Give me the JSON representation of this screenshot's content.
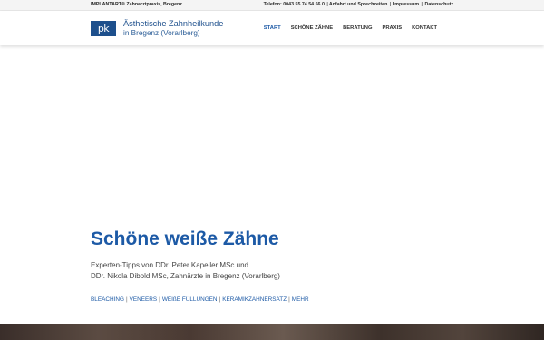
{
  "topbar": {
    "left_text": "IMPLANTART® Zahnarztpraxis, Bregenz",
    "phone": "Telefon: 0043 55 74 54 56 0",
    "links": [
      "Anfahrt und Sprechzeiten",
      "Impressum",
      "Datenschutz"
    ]
  },
  "header": {
    "logo_text": "pk",
    "brand_line1": "Ästhetische Zahnheilkunde",
    "brand_line2": "in Bregenz (Vorarlberg)",
    "nav": [
      "START",
      "SCHÖNE ZÄHNE",
      "BERATUNG",
      "PRAXIS",
      "KONTAKT"
    ],
    "active_nav": "START"
  },
  "hero": {
    "title": "Schöne weiße Zähne",
    "line1": "Experten-Tipps von DDr. Peter Kapeller MSc und",
    "line2": "DDr. Nikola Dibold MSc, Zahnärzte in Bregenz (Vorarlberg)",
    "links": [
      "BLEACHING",
      "VENEERS",
      "WEIßE FÜLLUNGEN",
      "KERAMIKZAHNERSATZ",
      "MEHR"
    ]
  },
  "colors": {
    "brand": "#1d4f8c",
    "accent": "#1d5aa6"
  }
}
